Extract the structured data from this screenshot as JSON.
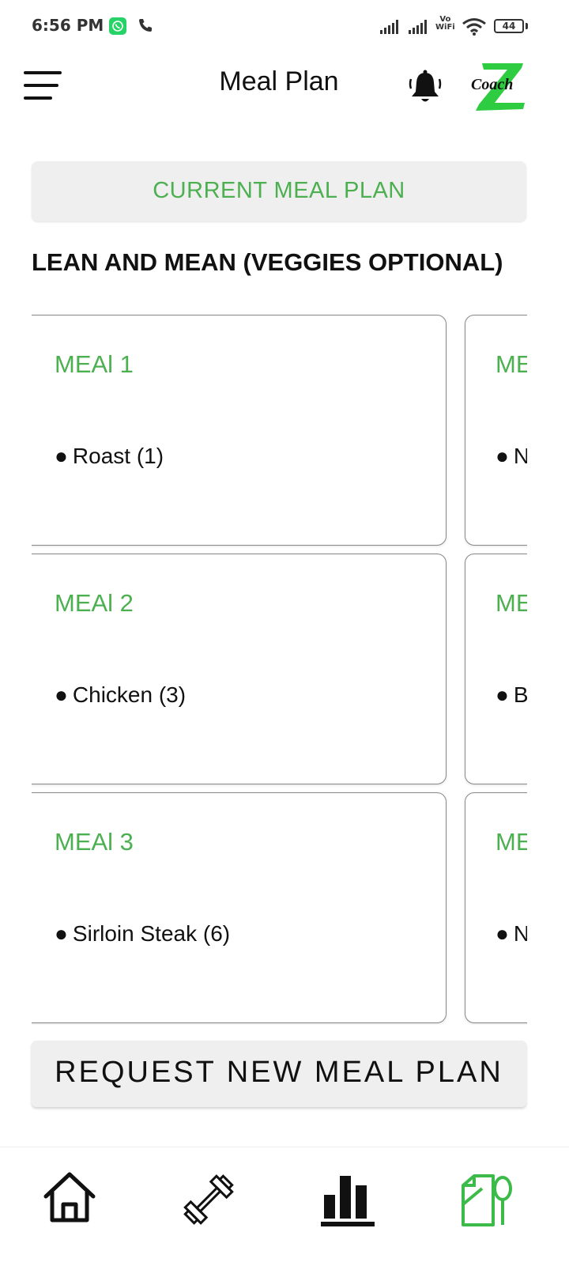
{
  "status_bar": {
    "time": "6:56 PM",
    "vowifi_line1": "Vo",
    "vowifi_line2": "WiFi",
    "battery": "44",
    "icons": [
      "whatsapp-icon",
      "call-icon",
      "signal-icon",
      "signal-icon",
      "wifi-icon",
      "battery-icon"
    ]
  },
  "header": {
    "title": "Meal Plan",
    "logo_text": "Coach",
    "icons": [
      "menu-icon",
      "bell-icon",
      "logo"
    ]
  },
  "current_plan_label": "CURRENT MEAL PLAN",
  "plan_name": "LEAN AND MEAN (VEGGIES OPTIONAL)",
  "meals": [
    {
      "title": "MEAl 1",
      "item": "Roast (1)",
      "next_title": "ME",
      "next_item": "N"
    },
    {
      "title": "MEAl 2",
      "item": "Chicken (3)",
      "next_title": "ME",
      "next_item": "B"
    },
    {
      "title": "MEAl 3",
      "item": "Sirloin Steak (6)",
      "next_title": "ME",
      "next_item": "N"
    }
  ],
  "bullet": "●",
  "request_label": "REQUEST NEW MEAL PLAN",
  "bottom_nav": {
    "items": [
      "home-icon",
      "workout-icon",
      "stats-icon",
      "meal-plan-icon"
    ],
    "active": "meal-plan-icon"
  },
  "colors": {
    "accent": "#4caf50",
    "button_bg": "#efefef",
    "text": "#111111"
  }
}
